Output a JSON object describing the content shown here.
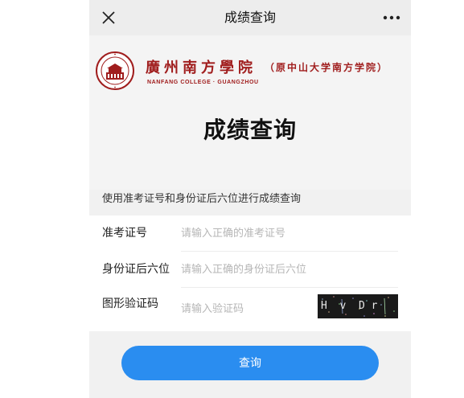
{
  "nav": {
    "title": "成绩查询",
    "close_icon": "close-icon",
    "more_icon": "more-icon"
  },
  "header": {
    "school_name": "廣州南方學院",
    "school_former": "（原中山大学南方学院）",
    "school_en": "NANFANG COLLEGE · GUANGZHOU",
    "page_heading": "成绩查询"
  },
  "instruction": "使用准考证号和身份证后六位进行成绩查询",
  "form": {
    "exam_id": {
      "label": "准考证号",
      "value": "",
      "placeholder": "请输入正确的准考证号"
    },
    "id_last6": {
      "label": "身份证后六位",
      "value": "",
      "placeholder": "请输入正确的身份证后六位"
    },
    "captcha": {
      "label": "图形验证码",
      "value": "",
      "placeholder": "请输入验证码",
      "image_text": "H  v  D r"
    }
  },
  "submit_label": "查询",
  "colors": {
    "brand_red": "#a01d1d",
    "primary_blue": "#2a8df0"
  }
}
